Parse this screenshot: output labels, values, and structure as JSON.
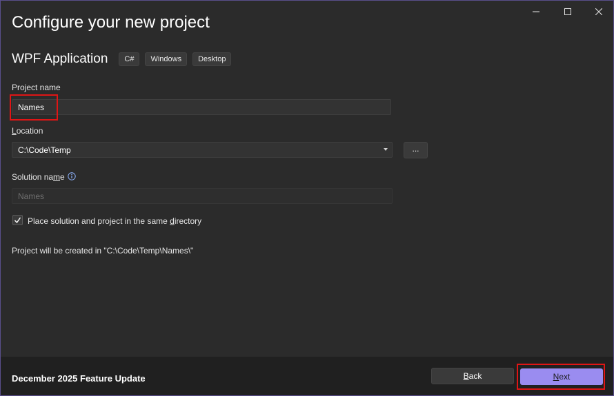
{
  "window": {
    "title": "Configure your new project"
  },
  "template": {
    "name": "WPF Application",
    "tags": [
      "C#",
      "Windows",
      "Desktop"
    ]
  },
  "project_name": {
    "label": "Project name",
    "value": "Names"
  },
  "location": {
    "label_pre": "",
    "label_underlined": "L",
    "label_post": "ocation",
    "value": "C:\\Code\\Temp",
    "browse_label": "..."
  },
  "solution_name": {
    "label_pre": "Solution na",
    "label_underlined": "m",
    "label_post": "e",
    "placeholder": "Names",
    "info_icon": "info-icon"
  },
  "same_directory": {
    "checked": true,
    "label_pre": "Place solution and project in the same ",
    "label_underlined": "d",
    "label_post": "irectory"
  },
  "created_path_text": "Project will be created in \"C:\\Code\\Temp\\Names\\\"",
  "footer": {
    "update_text": "December 2025 Feature Update",
    "back_pre": "",
    "back_underlined": "B",
    "back_post": "ack",
    "next_pre": "",
    "next_underlined": "N",
    "next_post": "ext"
  },
  "colors": {
    "accent": "#9a8cf0",
    "highlight": "#e01515",
    "background": "#2b2b2b",
    "footer": "#202020"
  }
}
